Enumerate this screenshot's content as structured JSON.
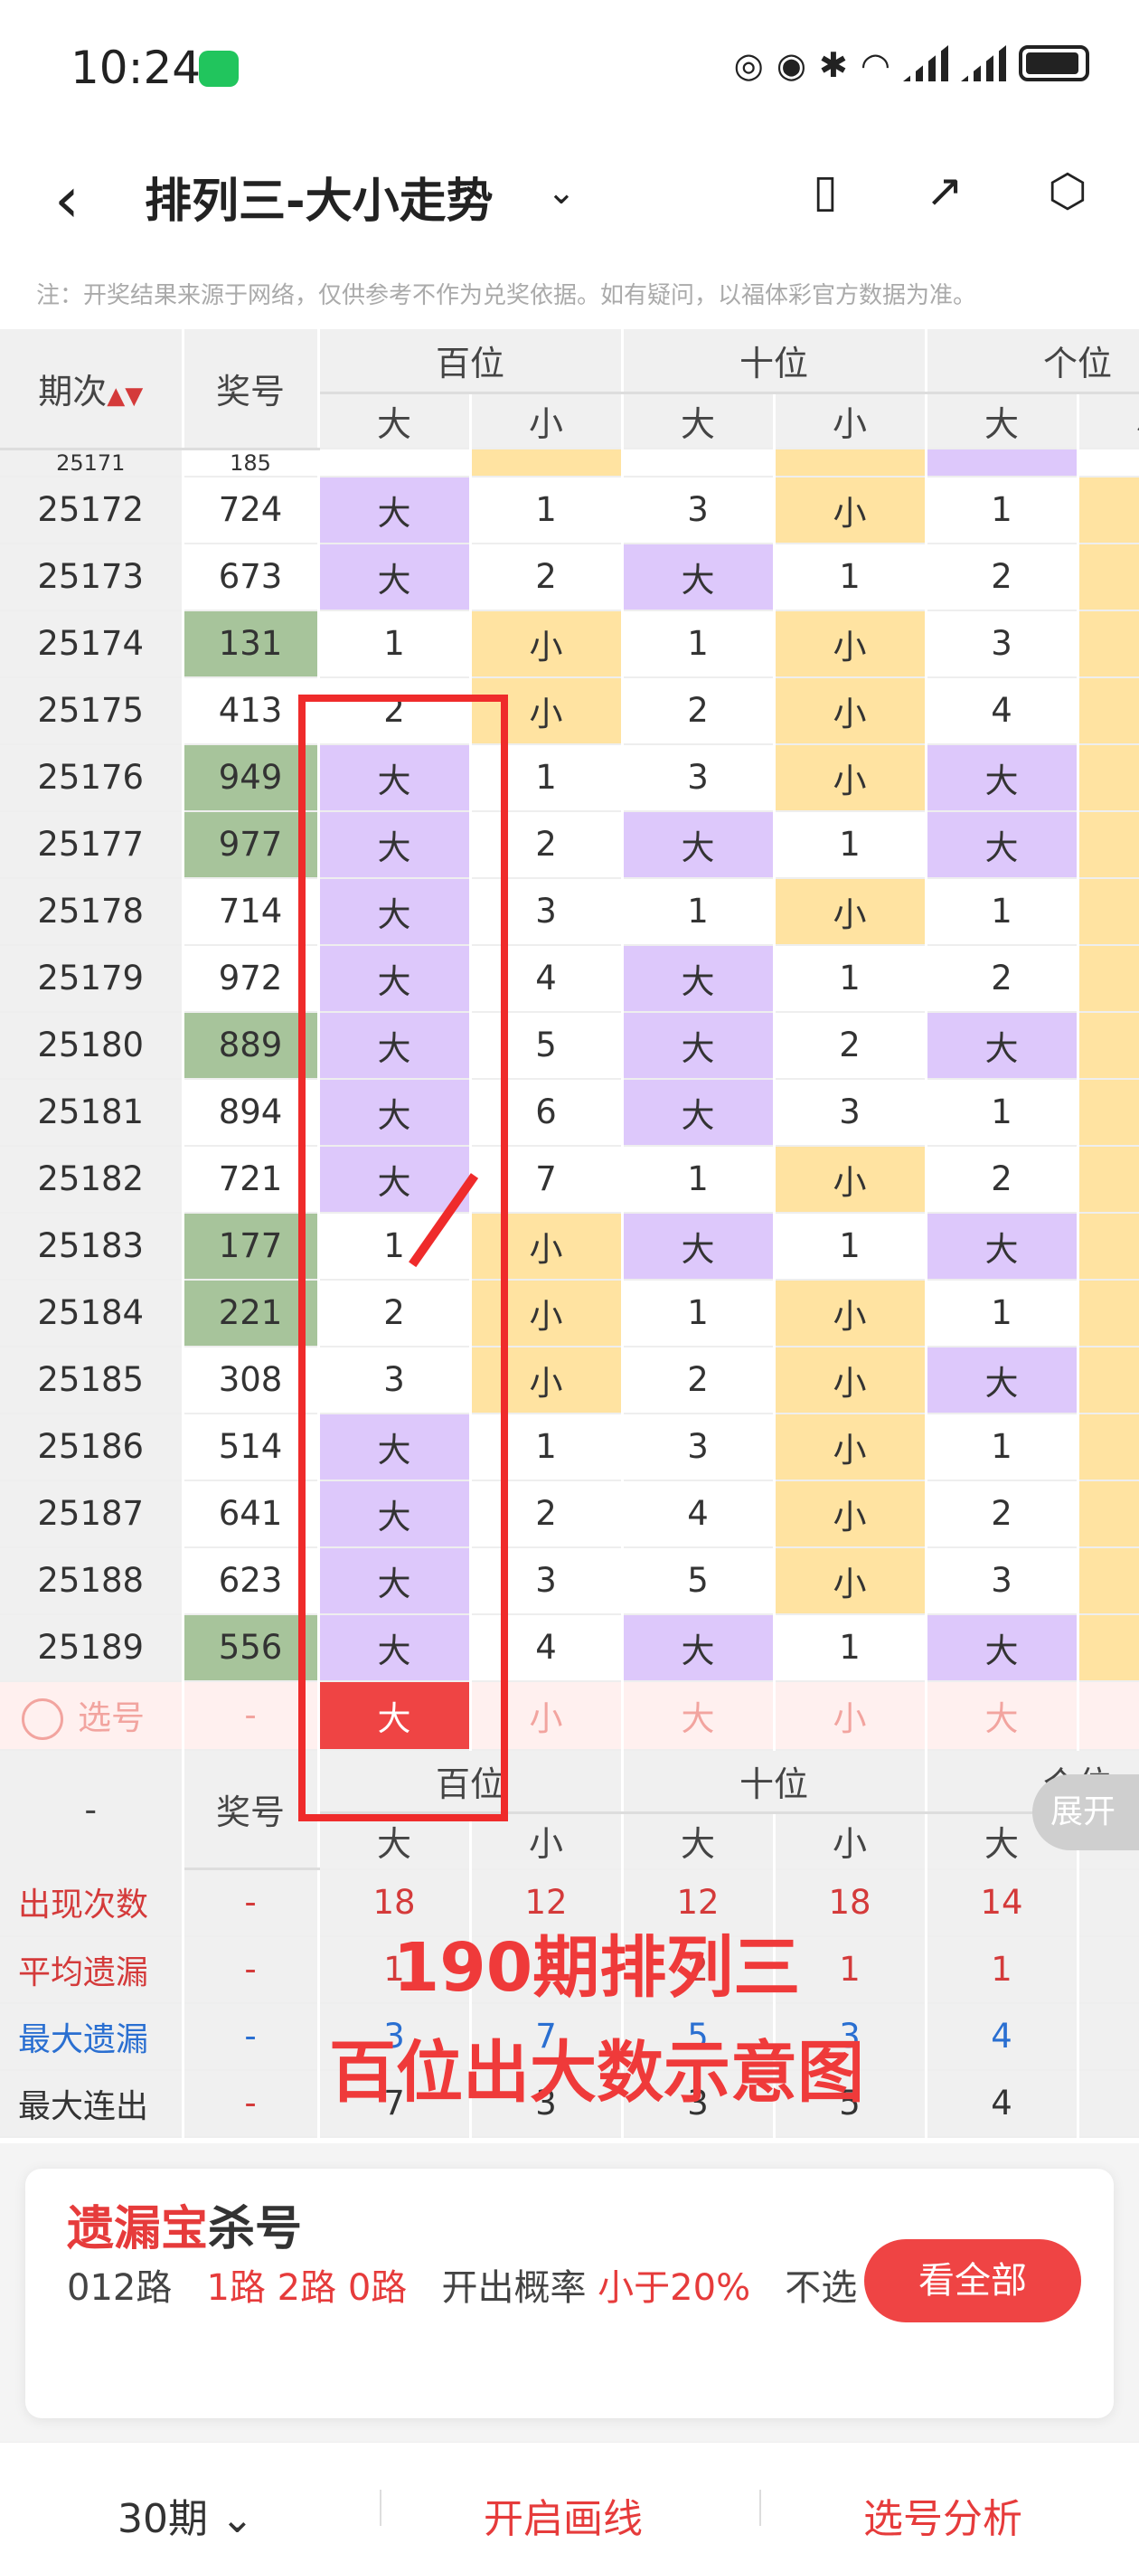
{
  "status": {
    "time": "10:24"
  },
  "nav": {
    "title": "排列三-大小走势",
    "chevron": "⌄"
  },
  "note": "注：开奖结果来源于网络，仅供参考不作为兑奖依据。如有疑问，以福体彩官方数据为准。",
  "table": {
    "h_issue": "期次",
    "h_num": "奖号",
    "positions": [
      "百位",
      "十位",
      "个位"
    ],
    "big": "大",
    "small": "小",
    "partial": {
      "issue": "25171",
      "num": "185"
    },
    "rows": [
      {
        "issue": "25172",
        "num": "724",
        "w": false,
        "c": [
          "大",
          "1",
          "3",
          "小",
          "1"
        ]
      },
      {
        "issue": "25173",
        "num": "673",
        "w": false,
        "c": [
          "大",
          "2",
          "大",
          "1",
          "2"
        ]
      },
      {
        "issue": "25174",
        "num": "131",
        "w": true,
        "c": [
          "1",
          "小",
          "1",
          "小",
          "3"
        ]
      },
      {
        "issue": "25175",
        "num": "413",
        "w": false,
        "c": [
          "2",
          "小",
          "2",
          "小",
          "4"
        ]
      },
      {
        "issue": "25176",
        "num": "949",
        "w": true,
        "c": [
          "大",
          "1",
          "3",
          "小",
          "大"
        ]
      },
      {
        "issue": "25177",
        "num": "977",
        "w": true,
        "c": [
          "大",
          "2",
          "大",
          "1",
          "大"
        ]
      },
      {
        "issue": "25178",
        "num": "714",
        "w": false,
        "c": [
          "大",
          "3",
          "1",
          "小",
          "1"
        ]
      },
      {
        "issue": "25179",
        "num": "972",
        "w": false,
        "c": [
          "大",
          "4",
          "大",
          "1",
          "2"
        ]
      },
      {
        "issue": "25180",
        "num": "889",
        "w": true,
        "c": [
          "大",
          "5",
          "大",
          "2",
          "大"
        ]
      },
      {
        "issue": "25181",
        "num": "894",
        "w": false,
        "c": [
          "大",
          "6",
          "大",
          "3",
          "1"
        ]
      },
      {
        "issue": "25182",
        "num": "721",
        "w": false,
        "c": [
          "大",
          "7",
          "1",
          "小",
          "2"
        ]
      },
      {
        "issue": "25183",
        "num": "177",
        "w": true,
        "c": [
          "1",
          "小",
          "大",
          "1",
          "大"
        ]
      },
      {
        "issue": "25184",
        "num": "221",
        "w": true,
        "c": [
          "2",
          "小",
          "1",
          "小",
          "1"
        ]
      },
      {
        "issue": "25185",
        "num": "308",
        "w": false,
        "c": [
          "3",
          "小",
          "2",
          "小",
          "大"
        ]
      },
      {
        "issue": "25186",
        "num": "514",
        "w": false,
        "c": [
          "大",
          "1",
          "3",
          "小",
          "1"
        ]
      },
      {
        "issue": "25187",
        "num": "641",
        "w": false,
        "c": [
          "大",
          "2",
          "4",
          "小",
          "2"
        ]
      },
      {
        "issue": "25188",
        "num": "623",
        "w": false,
        "c": [
          "大",
          "3",
          "5",
          "小",
          "3"
        ]
      },
      {
        "issue": "25189",
        "num": "556",
        "w": true,
        "c": [
          "大",
          "4",
          "大",
          "1",
          "大"
        ]
      }
    ],
    "select": {
      "label": "选号",
      "dash": "-",
      "c": [
        "大",
        "小",
        "大",
        "小",
        "大"
      ]
    },
    "foot": {
      "dash": "-",
      "num": "奖号"
    },
    "stats": [
      {
        "label": "出现次数",
        "v": [
          "-",
          "18",
          "12",
          "12",
          "18",
          "14"
        ],
        "cls": "red"
      },
      {
        "label": "平均遗漏",
        "v": [
          "-",
          "1",
          "2",
          "2",
          "1",
          "1"
        ],
        "cls": "red"
      },
      {
        "label": "最大遗漏",
        "v": [
          "-",
          "3",
          "7",
          "5",
          "3",
          "4"
        ],
        "cls": "blue"
      },
      {
        "label": "最大连出",
        "v": [
          "-",
          "7",
          "3",
          "3",
          "5",
          "4"
        ],
        "cls": ""
      }
    ]
  },
  "overlay": {
    "line1": "190期排列三",
    "line2": "百位出大数示意图"
  },
  "expand": "展开",
  "card": {
    "t1": "遗漏宝",
    "t2": "杀号",
    "road": "012路",
    "roads": "1路 2路 0路",
    "prob_label": "开出概率",
    "prob": "小于20%",
    "tail": "不选",
    "btn": "看全部"
  },
  "bottom": {
    "period": "30期 ⌄",
    "draw": "开启画线",
    "analysis": "选号分析"
  }
}
